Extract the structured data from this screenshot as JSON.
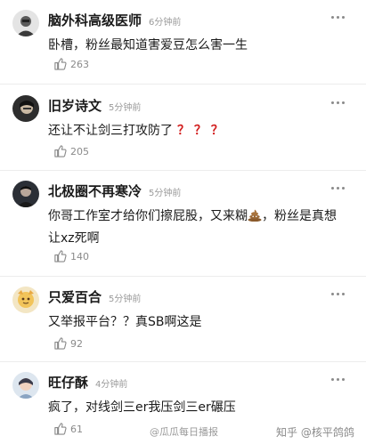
{
  "comments": [
    {
      "name": "脑外科高级医师",
      "time": "6分钟前",
      "text": "卧槽，粉丝最知道害爱豆怎么害一生",
      "likes": "263"
    },
    {
      "name": "旧岁诗文",
      "time": "5分钟前",
      "text": "还让不让剑三打攻防了",
      "marks": "？ ？ ？",
      "likes": "205"
    },
    {
      "name": "北极圈不再寒冷",
      "time": "5分钟前",
      "text": "你哥工作室才给你们擦屁股，又来糊",
      "text2": "，粉丝是真想让xz死啊",
      "likes": "140"
    },
    {
      "name": "只爱百合",
      "time": "5分钟前",
      "text": "又举报平台？？真SB啊这是",
      "likes": "92"
    },
    {
      "name": "旺仔酥",
      "time": "4分钟前",
      "text": "疯了，对线剑三er我压剑三er碾压",
      "likes": "61"
    }
  ],
  "watermark": {
    "weibo": "@瓜瓜每日播报",
    "zhihu": "知乎 @核平鸽鸽"
  },
  "colors": {
    "question_mark": "#d21f1f",
    "muted": "#8a8a8a"
  }
}
